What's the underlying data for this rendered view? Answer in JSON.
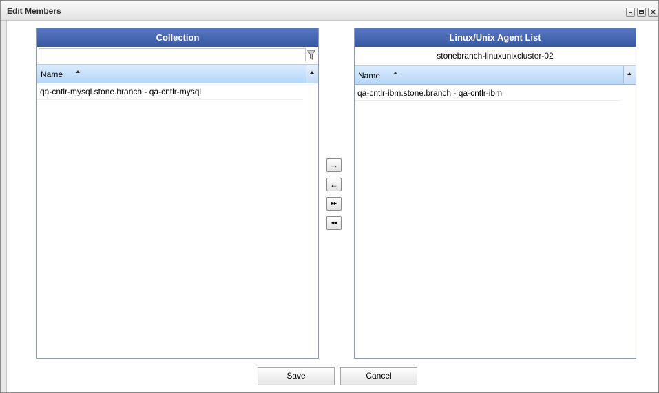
{
  "window": {
    "title": "Edit Members"
  },
  "left_panel": {
    "header": "Collection",
    "filter": {
      "value": "",
      "placeholder": ""
    },
    "column": "Name",
    "rows": [
      "qa-cntlr-mysql.stone.branch - qa-cntlr-mysql"
    ]
  },
  "right_panel": {
    "header": "Linux/Unix Agent List",
    "subtitle": "stonebranch-linuxunixcluster-02",
    "column": "Name",
    "rows": [
      "qa-cntlr-ibm.stone.branch - qa-cntlr-ibm"
    ]
  },
  "transfer": {
    "move_right": "→",
    "move_left": "←",
    "move_all_right": "▸▸",
    "move_all_left": "◂◂"
  },
  "footer": {
    "save_label": "Save",
    "cancel_label": "Cancel"
  },
  "colors": {
    "header": "#3f60ac",
    "grid_header": "#c6e0fa"
  }
}
